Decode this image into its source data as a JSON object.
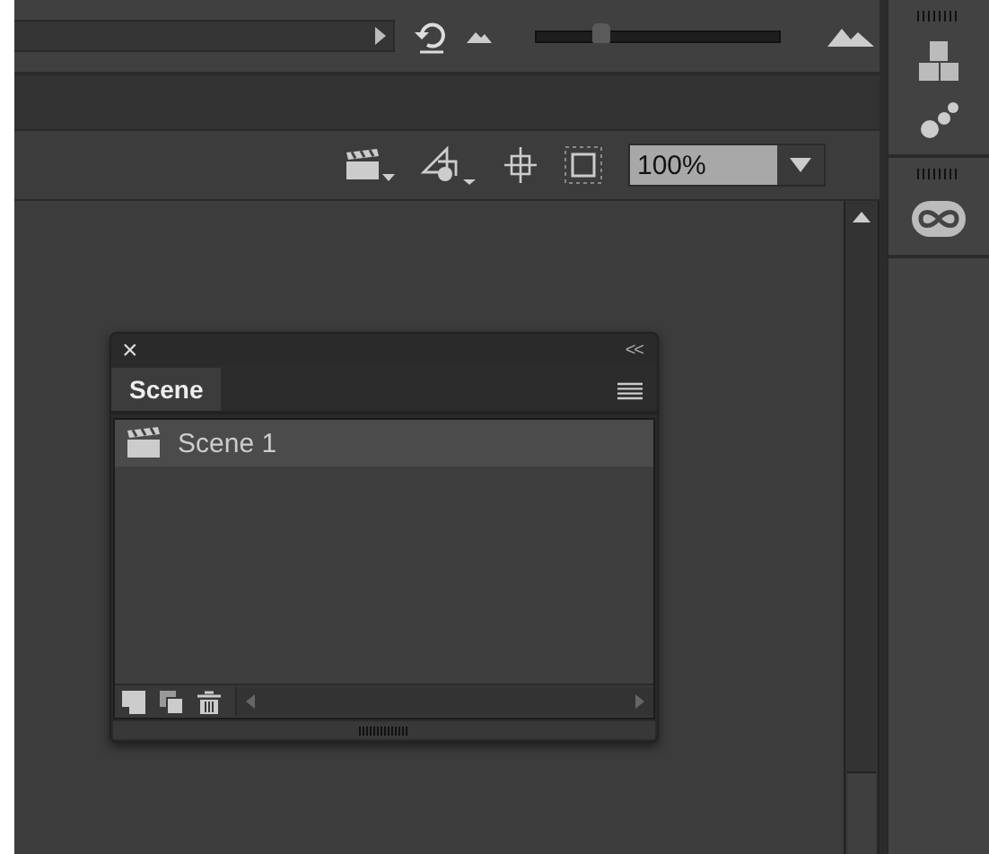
{
  "top_bar": {
    "zoom_slider": {
      "level": 0.27
    }
  },
  "toolbar": {
    "zoom_value": "100%"
  },
  "scene_panel": {
    "close": "×",
    "collapse": "<<",
    "tabs": [
      {
        "label": "Scene",
        "selected": true
      }
    ],
    "scenes": [
      {
        "name": "Scene 1",
        "selected": true
      }
    ]
  }
}
